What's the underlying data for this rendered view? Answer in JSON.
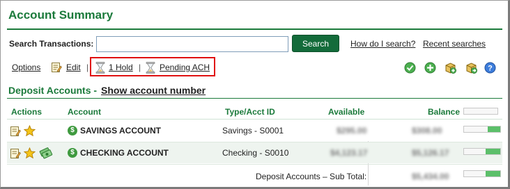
{
  "header": {
    "title": "Account Summary"
  },
  "search": {
    "label": "Search Transactions:",
    "input_value": "",
    "button_label": "Search",
    "how_link": "How do I search?",
    "recent_link": "Recent searches"
  },
  "toolbar": {
    "options_label": "Options",
    "edit_label": "Edit",
    "separator": "|",
    "hold_label": "1 Hold",
    "pending_ach_label": "Pending ACH",
    "right_icons": [
      "check-circle-icon",
      "plus-circle-icon",
      "package-add-icon",
      "package-forward-icon",
      "help-icon"
    ]
  },
  "deposit_section": {
    "title": "Deposit Accounts - ",
    "show_account_number": "Show account number",
    "columns": {
      "actions": "Actions",
      "account": "Account",
      "type": "Type/Acct ID",
      "available": "Available",
      "balance": "Balance"
    },
    "rows": [
      {
        "account": "SAVINGS ACCOUNT",
        "type": "Savings - S0001",
        "available": "$295.00",
        "balance": "$308.00",
        "balance_bar_fraction": 0.35,
        "action_icons": [
          "notepad-icon",
          "star-icon"
        ]
      },
      {
        "account": "CHECKING ACCOUNT",
        "type": "Checking - S0010",
        "available": "$4,123.17",
        "balance": "$5,126.17",
        "balance_bar_fraction": 0.4,
        "action_icons": [
          "notepad-icon",
          "star-icon",
          "money-transfer-icon"
        ]
      }
    ],
    "subtotal": {
      "label": "Deposit Accounts – Sub Total:",
      "balance": "$5,434.00",
      "balance_bar_fraction": 0.4
    }
  },
  "colors": {
    "brand_green": "#1b7a3b",
    "button_green": "#136b3a",
    "highlight_red": "#e01010",
    "bar_green": "#5cbf6a"
  }
}
